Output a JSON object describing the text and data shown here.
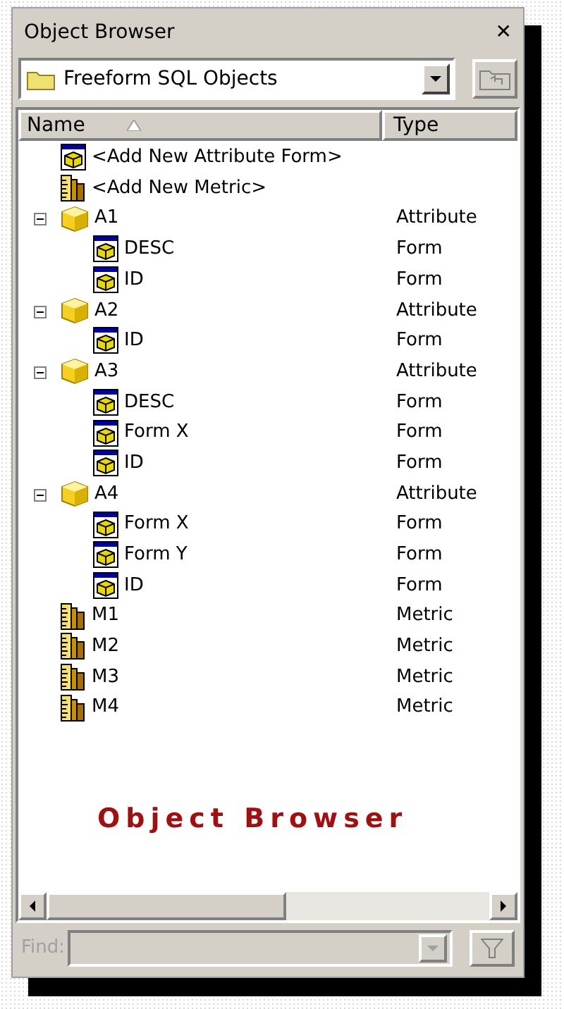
{
  "window": {
    "title": "Object Browser",
    "close": "✕"
  },
  "folder_dropdown": {
    "value": "Freeform SQL Objects"
  },
  "columns": [
    {
      "label": "Name",
      "sorted_ascending": true
    },
    {
      "label": "Type"
    }
  ],
  "tree": [
    {
      "kind": "form",
      "name": "<Add New Attribute Form>"
    },
    {
      "kind": "metric",
      "name": "<Add New Metric>"
    },
    {
      "kind": "attribute",
      "name": "A1",
      "type": "Attribute",
      "expanded": true,
      "children": [
        {
          "kind": "form",
          "name": "DESC",
          "type": "Form"
        },
        {
          "kind": "form",
          "name": "ID",
          "type": "Form"
        }
      ]
    },
    {
      "kind": "attribute",
      "name": "A2",
      "type": "Attribute",
      "expanded": true,
      "children": [
        {
          "kind": "form",
          "name": "ID",
          "type": "Form"
        }
      ]
    },
    {
      "kind": "attribute",
      "name": "A3",
      "type": "Attribute",
      "expanded": true,
      "children": [
        {
          "kind": "form",
          "name": "DESC",
          "type": "Form"
        },
        {
          "kind": "form",
          "name": "Form X",
          "type": "Form"
        },
        {
          "kind": "form",
          "name": "ID",
          "type": "Form"
        }
      ]
    },
    {
      "kind": "attribute",
      "name": "A4",
      "type": "Attribute",
      "expanded": true,
      "children": [
        {
          "kind": "form",
          "name": "Form X",
          "type": "Form"
        },
        {
          "kind": "form",
          "name": "Form Y",
          "type": "Form"
        },
        {
          "kind": "form",
          "name": "ID",
          "type": "Form"
        }
      ]
    },
    {
      "kind": "metric",
      "name": "M1",
      "type": "Metric"
    },
    {
      "kind": "metric",
      "name": "M2",
      "type": "Metric"
    },
    {
      "kind": "metric",
      "name": "M3",
      "type": "Metric"
    },
    {
      "kind": "metric",
      "name": "M4",
      "type": "Metric"
    }
  ],
  "caption": "Object Browser",
  "find": {
    "label": "Find:",
    "disabled": true
  }
}
